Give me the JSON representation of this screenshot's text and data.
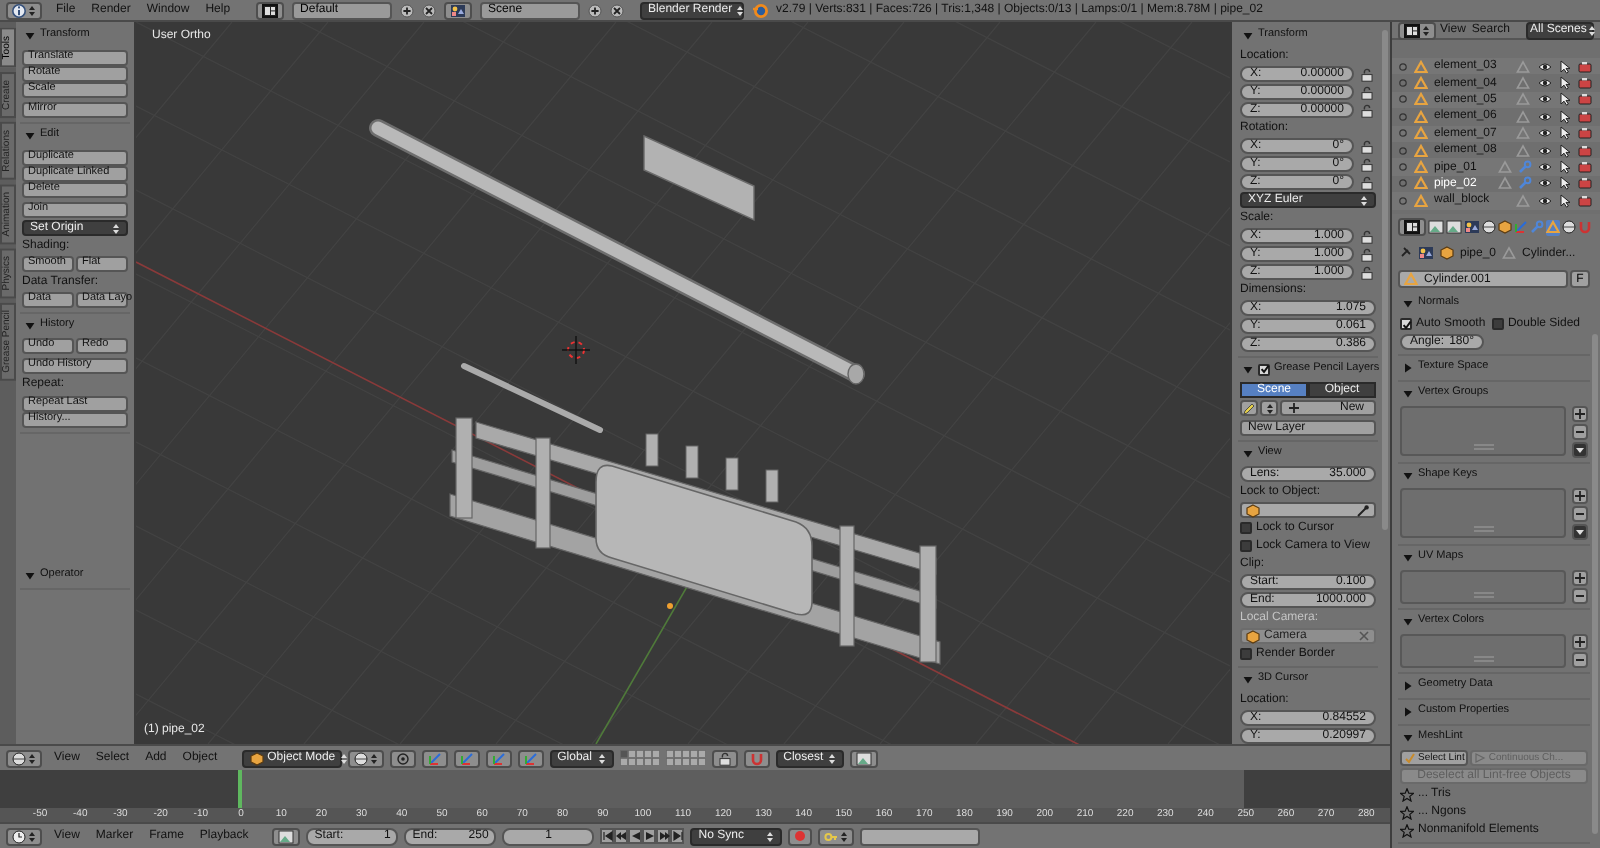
{
  "top_bar": {
    "menus": [
      "File",
      "Render",
      "Window",
      "Help"
    ],
    "layout": "Default",
    "scene": "Scene",
    "engine": "Blender Render",
    "stats": "v2.79 | Verts:831 | Faces:726 | Tris:1,348 | Objects:0/13 | Lamps:0/1 | Mem:8.78M | pipe_02"
  },
  "tool_tabs": [
    {
      "label": "Tools",
      "selected": true
    },
    {
      "label": "Create",
      "selected": false
    },
    {
      "label": "Relations",
      "selected": false
    },
    {
      "label": "Animation",
      "selected": false
    },
    {
      "label": "Physics",
      "selected": false
    },
    {
      "label": "Grease Pencil",
      "selected": false
    }
  ],
  "tool_shelf": {
    "panels": [
      {
        "title": "Transform",
        "expanded": true,
        "items": [
          {
            "kind": "column",
            "items": [
              "Translate",
              "Rotate",
              "Scale"
            ]
          },
          {
            "kind": "column",
            "items": [
              "Mirror"
            ]
          }
        ]
      },
      {
        "title": "Edit",
        "expanded": true,
        "items": [
          {
            "kind": "column",
            "items": [
              "Duplicate",
              "Duplicate Linked",
              "Delete"
            ]
          },
          {
            "kind": "column",
            "items": [
              "Join"
            ]
          },
          {
            "kind": "dropdown",
            "label": "Set Origin"
          },
          {
            "kind": "label",
            "text": "Shading:"
          },
          {
            "kind": "row",
            "items": [
              "Smooth",
              "Flat"
            ]
          },
          {
            "kind": "label",
            "text": "Data Transfer:"
          },
          {
            "kind": "row",
            "items": [
              "Data",
              "Data Layo"
            ]
          }
        ]
      },
      {
        "title": "History",
        "expanded": true,
        "items": [
          {
            "kind": "row",
            "items": [
              "Undo",
              "Redo"
            ]
          },
          {
            "kind": "column",
            "items": [
              "Undo History"
            ]
          },
          {
            "kind": "label",
            "text": "Repeat:"
          },
          {
            "kind": "column",
            "items": [
              "Repeat Last",
              "History..."
            ]
          }
        ]
      }
    ],
    "operator": {
      "title": "Operator",
      "expanded": true
    }
  },
  "viewport": {
    "view_name": "User Ortho",
    "object_label": "(1) pipe_02"
  },
  "n_panel": {
    "panels": [
      {
        "title": "Transform",
        "expanded": true,
        "items": [
          {
            "kind": "label",
            "text": "Location:"
          },
          {
            "kind": "number",
            "label": "X:",
            "value": "0.00000",
            "locked": false
          },
          {
            "kind": "number",
            "label": "Y:",
            "value": "0.00000",
            "locked": false
          },
          {
            "kind": "number",
            "label": "Z:",
            "value": "0.00000",
            "locked": false
          },
          {
            "kind": "label",
            "text": "Rotation:"
          },
          {
            "kind": "number",
            "label": "X:",
            "value": "0°",
            "locked": false
          },
          {
            "kind": "number",
            "label": "Y:",
            "value": "0°",
            "locked": false
          },
          {
            "kind": "number",
            "label": "Z:",
            "value": "0°",
            "locked": false
          },
          {
            "kind": "dropdown",
            "label": "XYZ Euler"
          },
          {
            "kind": "label",
            "text": "Scale:"
          },
          {
            "kind": "number",
            "label": "X:",
            "value": "1.000",
            "locked": false
          },
          {
            "kind": "number",
            "label": "Y:",
            "value": "1.000",
            "locked": false
          },
          {
            "kind": "number",
            "label": "Z:",
            "value": "1.000",
            "locked": false
          },
          {
            "kind": "label",
            "text": "Dimensions:"
          },
          {
            "kind": "number",
            "label": "X:",
            "value": "1.075"
          },
          {
            "kind": "number",
            "label": "Y:",
            "value": "0.061"
          },
          {
            "kind": "number",
            "label": "Z:",
            "value": "0.386"
          }
        ]
      },
      {
        "title": "Grease Pencil Layers",
        "expanded": true,
        "checked": true,
        "items": [
          {
            "kind": "tabs",
            "items": [
              {
                "label": "Scene",
                "selected": true
              },
              {
                "label": "Object",
                "selected": false
              }
            ]
          },
          {
            "kind": "new-row",
            "label": "New"
          },
          {
            "kind": "column",
            "items": [
              "New Layer"
            ]
          }
        ]
      },
      {
        "title": "View",
        "expanded": true,
        "items": [
          {
            "kind": "number",
            "label": "Lens:",
            "value": "35.000"
          },
          {
            "kind": "label",
            "text": "Lock to Object:"
          },
          {
            "kind": "object-field",
            "disabled": false
          },
          {
            "kind": "checkbox",
            "label": "Lock to Cursor",
            "checked": false
          },
          {
            "kind": "checkbox",
            "label": "Lock Camera to View",
            "checked": false
          },
          {
            "kind": "label",
            "text": "Clip:"
          },
          {
            "kind": "number",
            "label": "Start:",
            "value": "0.100"
          },
          {
            "kind": "number",
            "label": "End:",
            "value": "1000.000"
          },
          {
            "kind": "label",
            "text": "Local Camera:",
            "disabled": true
          },
          {
            "kind": "object-field",
            "value": "Camera",
            "disabled": true
          },
          {
            "kind": "checkbox",
            "label": "Render Border",
            "checked": false
          }
        ]
      },
      {
        "title": "3D Cursor",
        "expanded": true,
        "items": [
          {
            "kind": "label",
            "text": "Location:"
          },
          {
            "kind": "number",
            "label": "X:",
            "value": "0.84552"
          },
          {
            "kind": "number",
            "label": "Y:",
            "value": "0.20997"
          }
        ]
      }
    ]
  },
  "outliner": {
    "menus": [
      "View",
      "Search"
    ],
    "display_mode": "All Scenes",
    "rows": [
      {
        "name": "element_03",
        "selected": false,
        "modifier": false
      },
      {
        "name": "element_04",
        "selected": false,
        "modifier": false
      },
      {
        "name": "element_05",
        "selected": false,
        "modifier": false
      },
      {
        "name": "element_06",
        "selected": false,
        "modifier": false
      },
      {
        "name": "element_07",
        "selected": false,
        "modifier": false
      },
      {
        "name": "element_08",
        "selected": false,
        "modifier": false
      },
      {
        "name": "pipe_01",
        "selected": false,
        "modifier": true
      },
      {
        "name": "pipe_02",
        "selected": true,
        "modifier": true
      },
      {
        "name": "wall_block",
        "selected": false,
        "modifier": false
      }
    ]
  },
  "properties": {
    "editor_tabs": [
      {
        "selected": false
      },
      {
        "selected": false
      },
      {
        "selected": false
      },
      {
        "selected": false
      },
      {
        "selected": false
      },
      {
        "selected": false
      },
      {
        "selected": false
      },
      {
        "selected": true
      },
      {
        "selected": false
      },
      {
        "selected": false
      }
    ],
    "breadcrumb": [
      "pipe_0",
      "Cylinder..."
    ],
    "datablock": "Cylinder.001",
    "fake_user": "F",
    "panels": [
      {
        "title": "Normals",
        "expanded": true,
        "items": [
          {
            "kind": "checkbox-row",
            "items": [
              {
                "label": "Auto Smooth",
                "checked": true
              },
              {
                "label": "Double Sided",
                "checked": false
              }
            ]
          },
          {
            "kind": "spinner",
            "label": "Angle:",
            "value": "180°"
          }
        ]
      },
      {
        "title": "Texture Space",
        "expanded": false
      },
      {
        "title": "Vertex Groups",
        "expanded": true,
        "items": [
          {
            "kind": "list-box",
            "menu": true
          }
        ]
      },
      {
        "title": "Shape Keys",
        "expanded": true,
        "items": [
          {
            "kind": "list-box",
            "menu": true
          }
        ]
      },
      {
        "title": "UV Maps",
        "expanded": true,
        "items": [
          {
            "kind": "list-box",
            "menu": false
          }
        ]
      },
      {
        "title": "Vertex Colors",
        "expanded": true,
        "items": [
          {
            "kind": "list-box",
            "menu": false
          }
        ]
      },
      {
        "title": "Geometry Data",
        "expanded": false
      },
      {
        "title": "Custom Properties",
        "expanded": false
      },
      {
        "title": "MeshLint",
        "expanded": true,
        "items": [
          {
            "kind": "button-row",
            "items": [
              {
                "label": "Select Lint",
                "disabled": false
              },
              {
                "label": "Continuous Ch...",
                "disabled": true
              }
            ]
          },
          {
            "kind": "button",
            "label": "Deselect all Lint-free Objects",
            "disabled": true
          },
          {
            "kind": "check-item",
            "label": "... Tris"
          },
          {
            "kind": "check-item",
            "label": "... Ngons"
          },
          {
            "kind": "check-item",
            "label": "Nonmanifold Elements"
          }
        ]
      }
    ]
  },
  "view3d_header": {
    "menus": [
      "View",
      "Select",
      "Add",
      "Object"
    ],
    "mode": "Object Mode",
    "orientation": "Global",
    "snap_target": "Closest"
  },
  "timeline": {
    "ruler": [
      "-50",
      "-40",
      "-30",
      "-20",
      "-10",
      "0",
      "10",
      "20",
      "30",
      "40",
      "50",
      "60",
      "70",
      "80",
      "90",
      "100",
      "110",
      "120",
      "130",
      "140",
      "150",
      "160",
      "170",
      "180",
      "190",
      "200",
      "210",
      "220",
      "230",
      "240",
      "250",
      "260",
      "270",
      "280"
    ]
  },
  "timeline_header": {
    "menus": [
      "View",
      "Marker",
      "Frame",
      "Playback"
    ],
    "start": {
      "label": "Start:",
      "value": "1"
    },
    "end": {
      "label": "End:",
      "value": "250"
    },
    "current": "1",
    "sync": "No Sync"
  }
}
